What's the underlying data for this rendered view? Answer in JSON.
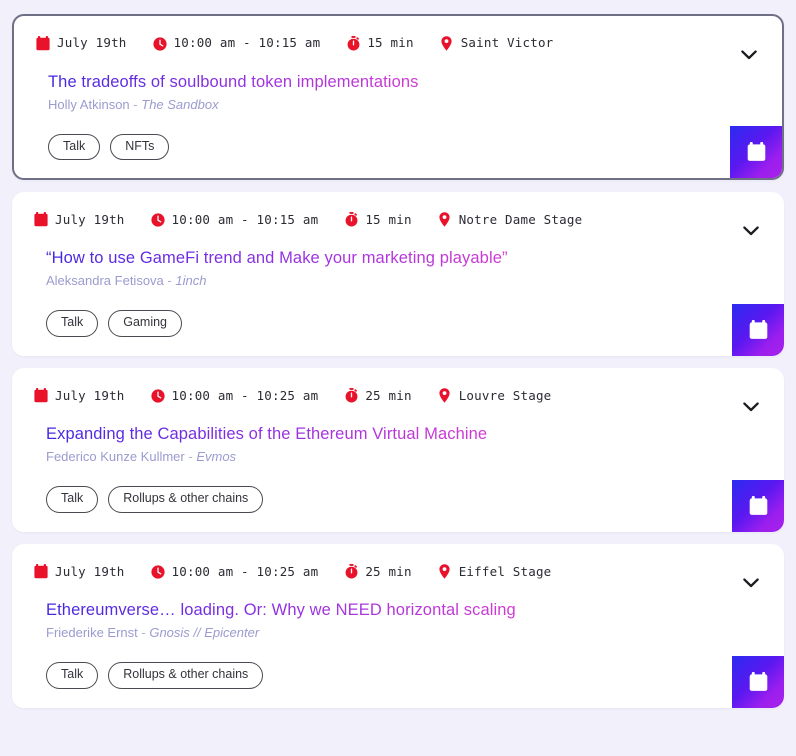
{
  "page": {
    "background_color": "#f1f0fb",
    "card_background": "#ffffff",
    "selected_border_color": "#6f6f86",
    "title_gradient_start": "#4328e0",
    "title_gradient_end": "#d23ad2",
    "meta_icon_color": "#e8132b",
    "speaker_color": "#9b9bd0",
    "calendar_gradient_start": "#2b2bf0",
    "calendar_gradient_end": "#a820e8"
  },
  "icons": {
    "calendar": "calendar-icon",
    "clock": "clock-icon",
    "stopwatch": "stopwatch-icon",
    "location": "location-pin-icon",
    "chevron": "chevron-down-icon",
    "add_to_calendar": "calendar-icon"
  },
  "sessions": [
    {
      "selected": true,
      "date": "July 19th",
      "time": "10:00 am - 10:15 am",
      "duration": "15 min",
      "location": "Saint Victor",
      "title": "The tradeoffs of soulbound token implementations",
      "speaker": "Holly Atkinson",
      "separator": "-",
      "company": "The Sandbox",
      "tags": [
        "Talk",
        "NFTs"
      ]
    },
    {
      "selected": false,
      "date": "July 19th",
      "time": "10:00 am - 10:15 am",
      "duration": "15 min",
      "location": "Notre Dame Stage",
      "title": "“How to use GameFi trend and Make your marketing playable”",
      "speaker": "Aleksandra Fetisova",
      "separator": "-",
      "company": "1inch",
      "tags": [
        "Talk",
        "Gaming"
      ]
    },
    {
      "selected": false,
      "date": "July 19th",
      "time": "10:00 am - 10:25 am",
      "duration": "25 min",
      "location": "Louvre Stage",
      "title": "Expanding the Capabilities of the Ethereum Virtual Machine",
      "speaker": "Federico Kunze Kullmer",
      "separator": "-",
      "company": "Evmos",
      "tags": [
        "Talk",
        "Rollups & other chains"
      ]
    },
    {
      "selected": false,
      "date": "July 19th",
      "time": "10:00 am - 10:25 am",
      "duration": "25 min",
      "location": "Eiffel Stage",
      "title": "Ethereumverse… loading. Or: Why we NEED horizontal scaling",
      "speaker": "Friederike Ernst",
      "separator": "-",
      "company": "Gnosis // Epicenter",
      "tags": [
        "Talk",
        "Rollups & other chains"
      ]
    }
  ]
}
